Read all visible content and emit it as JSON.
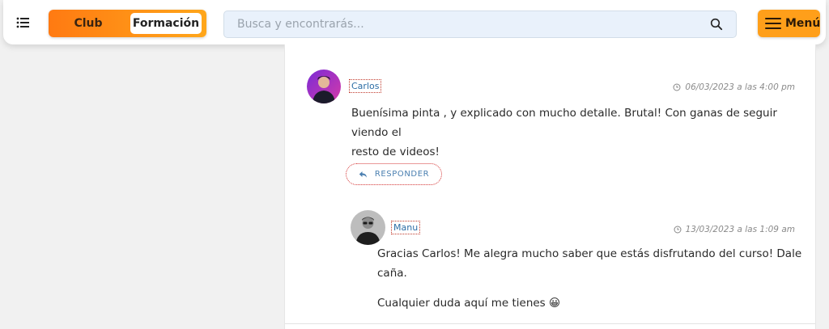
{
  "header": {
    "list_icon": "list-icon",
    "toggle": {
      "club_label": "Club",
      "formacion_label": "Formación"
    },
    "search": {
      "placeholder": "Busca y encontrarás...",
      "value": "",
      "icon": "search-icon"
    },
    "menu_label": "Menú",
    "accent_orange": "#ff9f1a"
  },
  "comments": [
    {
      "author": "Carlos",
      "date": "06/03/2023 a las 4:00 pm",
      "lines": [
        "Buenísima pinta , y explicado con mucho detalle. Brutal! Con ganas de seguir viendo el",
        "resto de videos!"
      ],
      "reply_label": "RESPONDER"
    },
    {
      "author": "Manu",
      "date": "13/03/2023 a las 1:09 am",
      "paragraphs": [
        "Gracias Carlos! Me alegra mucho saber que estás disfrutando del curso! Dale caña.",
        "Cualquier duda aquí me tienes 😀"
      ]
    }
  ]
}
